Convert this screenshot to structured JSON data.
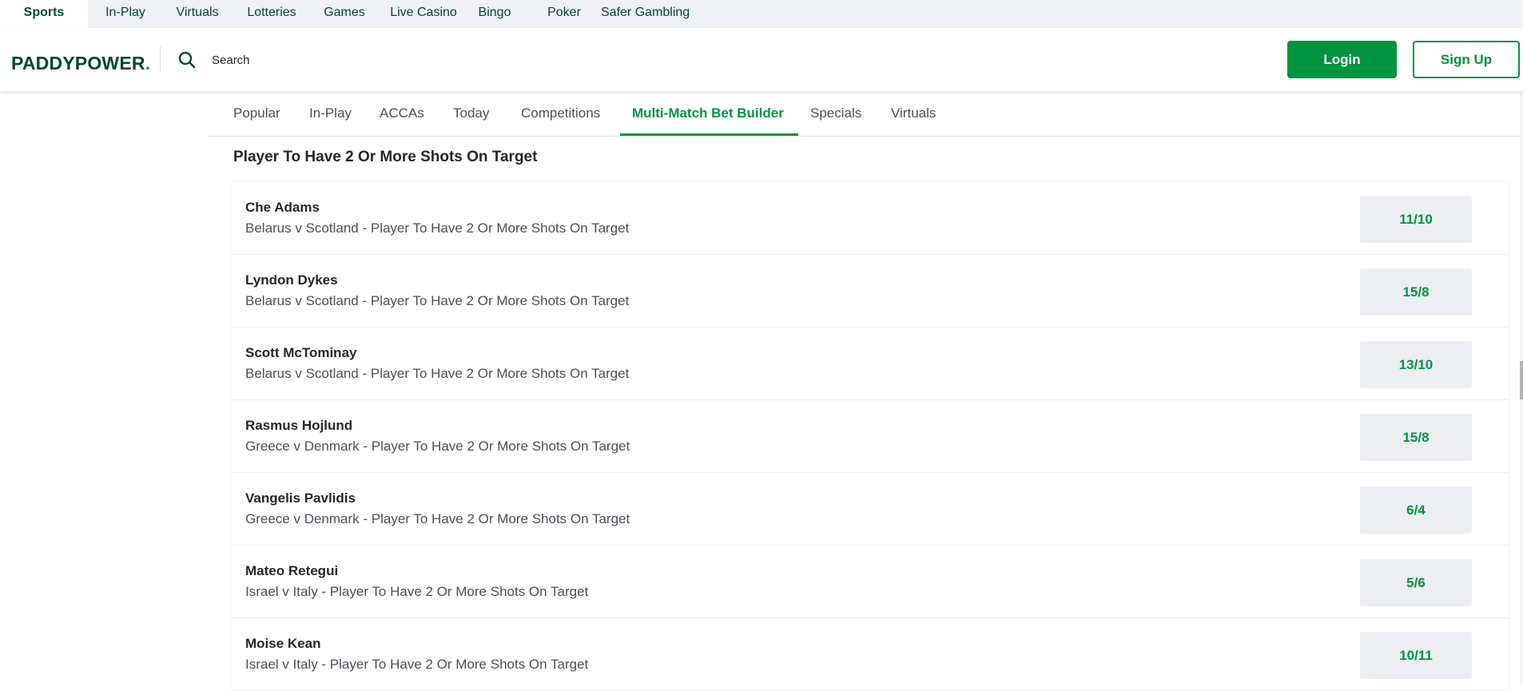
{
  "top_nav": [
    {
      "label": "Sports",
      "active": true
    },
    {
      "label": "In-Play"
    },
    {
      "label": "Virtuals"
    },
    {
      "label": "Lotteries"
    },
    {
      "label": "Games"
    },
    {
      "label": "Live Casino"
    },
    {
      "label": "Bingo"
    },
    {
      "label": "Poker"
    },
    {
      "label": "Safer Gambling"
    }
  ],
  "header": {
    "logo_text": "PADDYPOWER",
    "logo_dot": ".",
    "search_label": "Search",
    "login_label": "Login",
    "signup_label": "Sign Up"
  },
  "sub_tabs": [
    {
      "label": "Popular"
    },
    {
      "label": "In-Play"
    },
    {
      "label": "ACCAs"
    },
    {
      "label": "Today"
    },
    {
      "label": "Competitions"
    },
    {
      "label": "Multi-Match Bet Builder",
      "active": true
    },
    {
      "label": "Specials"
    },
    {
      "label": "Virtuals"
    }
  ],
  "section": {
    "title": "Player To Have 2 Or More Shots On Target",
    "rows": [
      {
        "player": "Che Adams",
        "market": "Belarus v Scotland - Player To Have 2 Or More Shots On Target",
        "odds": "11/10"
      },
      {
        "player": "Lyndon Dykes",
        "market": "Belarus v Scotland - Player To Have 2 Or More Shots On Target",
        "odds": "15/8"
      },
      {
        "player": "Scott McTominay",
        "market": "Belarus v Scotland - Player To Have 2 Or More Shots On Target",
        "odds": "13/10"
      },
      {
        "player": "Rasmus Hojlund",
        "market": "Greece v Denmark - Player To Have 2 Or More Shots On Target",
        "odds": "15/8"
      },
      {
        "player": "Vangelis Pavlidis",
        "market": "Greece v Denmark - Player To Have 2 Or More Shots On Target",
        "odds": "6/4"
      },
      {
        "player": "Mateo Retegui",
        "market": "Israel v Italy - Player To Have 2 Or More Shots On Target",
        "odds": "5/6"
      },
      {
        "player": "Moise Kean",
        "market": "Israel v Italy - Player To Have 2 Or More Shots On Target",
        "odds": "10/11"
      }
    ]
  },
  "colors": {
    "brand_dark": "#004833",
    "brand_green": "#00943f",
    "odds_bg": "#eceef2",
    "nav_bg": "#f0f1f4"
  }
}
